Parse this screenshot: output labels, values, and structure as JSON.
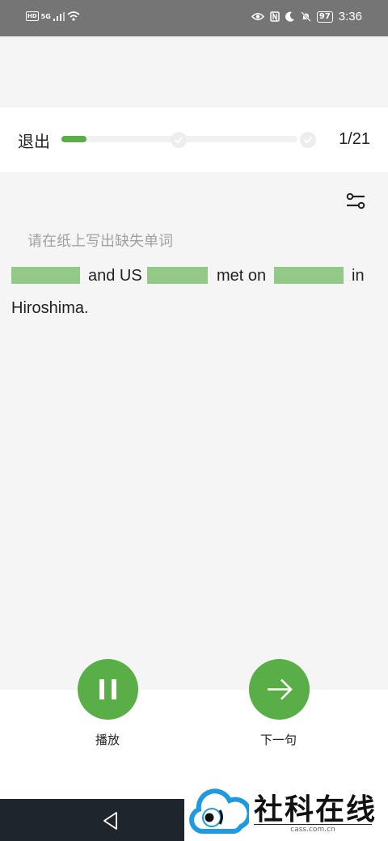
{
  "status_bar": {
    "left_badges": [
      "HD",
      "5G"
    ],
    "battery": "97",
    "time": "3:36"
  },
  "header": {
    "exit_label": "退出",
    "progress_count": "1/21",
    "progress_fraction": 0.048
  },
  "content": {
    "hint": "请在纸上写出缺失单词",
    "sentence_parts": [
      "and US",
      "met on",
      "in",
      "Hiroshima."
    ]
  },
  "controls": {
    "play_label": "播放",
    "next_label": "下一句"
  },
  "watermark": {
    "name": "社科在线",
    "url": "cass.com.cn"
  },
  "colors": {
    "accent": "#5aae47",
    "blank": "#93c986"
  }
}
